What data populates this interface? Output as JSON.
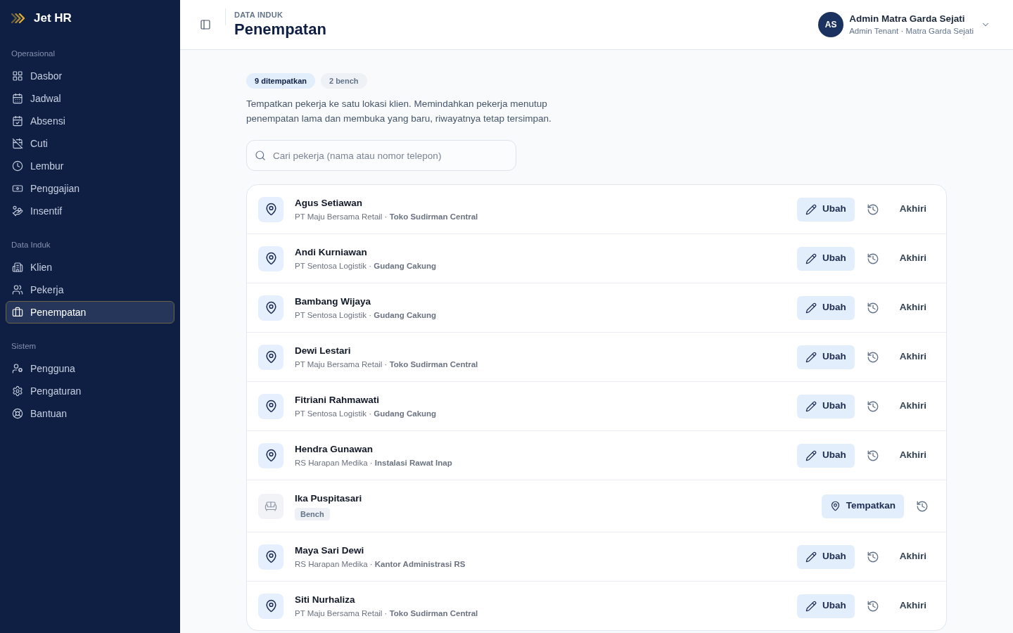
{
  "sidebar": {
    "brand": "Jet HR",
    "sections": [
      {
        "title": "Operasional",
        "items": [
          {
            "label": "Dasbor",
            "selected": false
          },
          {
            "label": "Jadwal",
            "selected": false
          },
          {
            "label": "Absensi",
            "selected": false
          },
          {
            "label": "Cuti",
            "selected": false
          },
          {
            "label": "Lembur",
            "selected": false
          },
          {
            "label": "Penggajian",
            "selected": false
          },
          {
            "label": "Insentif",
            "selected": false
          }
        ]
      },
      {
        "title": "Data Induk",
        "items": [
          {
            "label": "Klien",
            "selected": false
          },
          {
            "label": "Pekerja",
            "selected": false
          },
          {
            "label": "Penempatan",
            "selected": true
          }
        ]
      },
      {
        "title": "Sistem",
        "items": [
          {
            "label": "Pengguna",
            "selected": false
          },
          {
            "label": "Pengaturan",
            "selected": false
          },
          {
            "label": "Bantuan",
            "selected": false
          }
        ]
      }
    ]
  },
  "header": {
    "eyebrow": "DATA INDUK",
    "title": "Penempatan",
    "user": {
      "initials": "AS",
      "name": "Admin Matra Garda Sejati",
      "role": "Admin Tenant · Matra Garda Sejati"
    }
  },
  "counts": [
    {
      "kind": "placed",
      "label": "9 ditempatkan"
    },
    {
      "kind": "bench",
      "label": "2 bench"
    }
  ],
  "description": "Tempatkan pekerja ke satu lokasi klien. Memindahkan pekerja menutup penempatan lama dan membuka yang baru, riwayatnya tetap tersimpan.",
  "search": {
    "placeholder": "Cari pekerja (nama atau nomor telepon)"
  },
  "placements": [
    {
      "kind": "placed",
      "name": "Agus Setiawan",
      "subtitle": "PT Maju Bersama Retail · **Toko Sudirman Central**",
      "actions": [
        {
          "kind": "edit",
          "label": "Ubah"
        },
        {
          "kind": "history"
        },
        {
          "kind": "end",
          "label": "Akhiri"
        }
      ]
    },
    {
      "kind": "placed",
      "name": "Andi Kurniawan",
      "subtitle": "PT Sentosa Logistik · **Gudang Cakung**",
      "actions": [
        {
          "kind": "edit",
          "label": "Ubah"
        },
        {
          "kind": "history"
        },
        {
          "kind": "end",
          "label": "Akhiri"
        }
      ]
    },
    {
      "kind": "placed",
      "name": "Bambang Wijaya",
      "subtitle": "PT Sentosa Logistik · **Gudang Cakung**",
      "actions": [
        {
          "kind": "edit",
          "label": "Ubah"
        },
        {
          "kind": "history"
        },
        {
          "kind": "end",
          "label": "Akhiri"
        }
      ]
    },
    {
      "kind": "placed",
      "name": "Dewi Lestari",
      "subtitle": "PT Maju Bersama Retail · **Toko Sudirman Central**",
      "actions": [
        {
          "kind": "edit",
          "label": "Ubah"
        },
        {
          "kind": "history"
        },
        {
          "kind": "end",
          "label": "Akhiri"
        }
      ]
    },
    {
      "kind": "placed",
      "name": "Fitriani Rahmawati",
      "subtitle": "PT Sentosa Logistik · **Gudang Cakung**",
      "actions": [
        {
          "kind": "edit",
          "label": "Ubah"
        },
        {
          "kind": "history"
        },
        {
          "kind": "end",
          "label": "Akhiri"
        }
      ]
    },
    {
      "kind": "placed",
      "name": "Hendra Gunawan",
      "subtitle": "RS Harapan Medika · **Instalasi Rawat Inap**",
      "actions": [
        {
          "kind": "edit",
          "label": "Ubah"
        },
        {
          "kind": "history"
        },
        {
          "kind": "end",
          "label": "Akhiri"
        }
      ]
    },
    {
      "kind": "bench",
      "name": "Ika Puspitasari",
      "tag": "Bench",
      "actions": [
        {
          "kind": "place",
          "label": "Tempatkan"
        },
        {
          "kind": "history"
        }
      ]
    },
    {
      "kind": "placed",
      "name": "Maya Sari Dewi",
      "subtitle": "RS Harapan Medika · **Kantor Administrasi RS**",
      "actions": [
        {
          "kind": "edit",
          "label": "Ubah"
        },
        {
          "kind": "history"
        },
        {
          "kind": "end",
          "label": "Akhiri"
        }
      ]
    },
    {
      "kind": "placed",
      "name": "Siti Nurhaliza",
      "subtitle": "PT Maju Bersama Retail · **Toko Sudirman Central**",
      "actions": [
        {
          "kind": "edit",
          "label": "Ubah"
        },
        {
          "kind": "history"
        },
        {
          "kind": "end",
          "label": "Akhiri"
        }
      ]
    }
  ]
}
